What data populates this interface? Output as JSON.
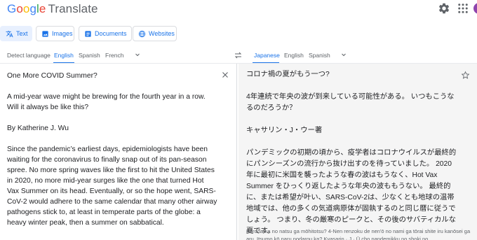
{
  "header": {
    "logo_letters": [
      "G",
      "o",
      "o",
      "g",
      "l",
      "e"
    ],
    "product_name": "Translate",
    "icons": [
      "gear-icon",
      "apps-grid-icon",
      "account-avatar"
    ]
  },
  "modes": [
    {
      "label": "Text",
      "icon": "translate-icon",
      "active": true
    },
    {
      "label": "Images",
      "icon": "image-icon",
      "active": false
    },
    {
      "label": "Documents",
      "icon": "document-icon",
      "active": false
    },
    {
      "label": "Websites",
      "icon": "globe-icon",
      "active": false
    }
  ],
  "source_languages": [
    "Detect language",
    "English",
    "Spanish",
    "French"
  ],
  "source_selected": "English",
  "target_languages": [
    "Japanese",
    "English",
    "Spanish"
  ],
  "target_selected": "Japanese",
  "source_text": [
    "One More COVID Summer?",
    "A mid-year wave might be brewing for the fourth year in a row. Will it always be like this?",
    "By Katherine J. Wu",
    "Since the pandemic’s earliest days, epidemiologists have been waiting for the coronavirus to finally snap out of its pan-season spree. No more spring waves like the first to hit the United States in 2020, no more mid-year surges like the one that turned Hot Vax Summer on its head. Eventually, or so the hope went, SARS-CoV-2 would adhere to the same calendar that many other airway pathogens stick to, at least in temperate parts of the globe: a heavy winter peak, then a summer on sabbatical."
  ],
  "target_text": [
    "コロナ禍の夏がもう一つ?",
    "4年連続で年央の波が到来している可能性がある。 いつもこうなるのだろうか？",
    "キャサリン・J・ウー著",
    "パンデミックの初期の頃から、疫学者はコロナウイルスが最終的にパンシーズンの流行から抜け出すのを待っていました。 2020年に最初に米国を襲ったような春の波はもうなく、Hot Vax Summer をひっくり返したような年央の波ももうない。 最終的に、または希望が叶い、SARS-CoV-2は、少なくとも地球の温帯地域では、他の多くの気道病原体が固執するのと同じ暦に従うでしょう。 つまり、冬の厳寒のピークと、その後のサバティカルな夏です。"
  ],
  "transliteration": "Korona-ka no natsu ga mōhitotsu? 4-Nen renzoku de nen'ō no nami ga tōrai shite iru kanōsei ga aru. Itsumo kō naru nodarou ka? Kyasarin · J · Ū cho pandemikku no shoki no"
}
